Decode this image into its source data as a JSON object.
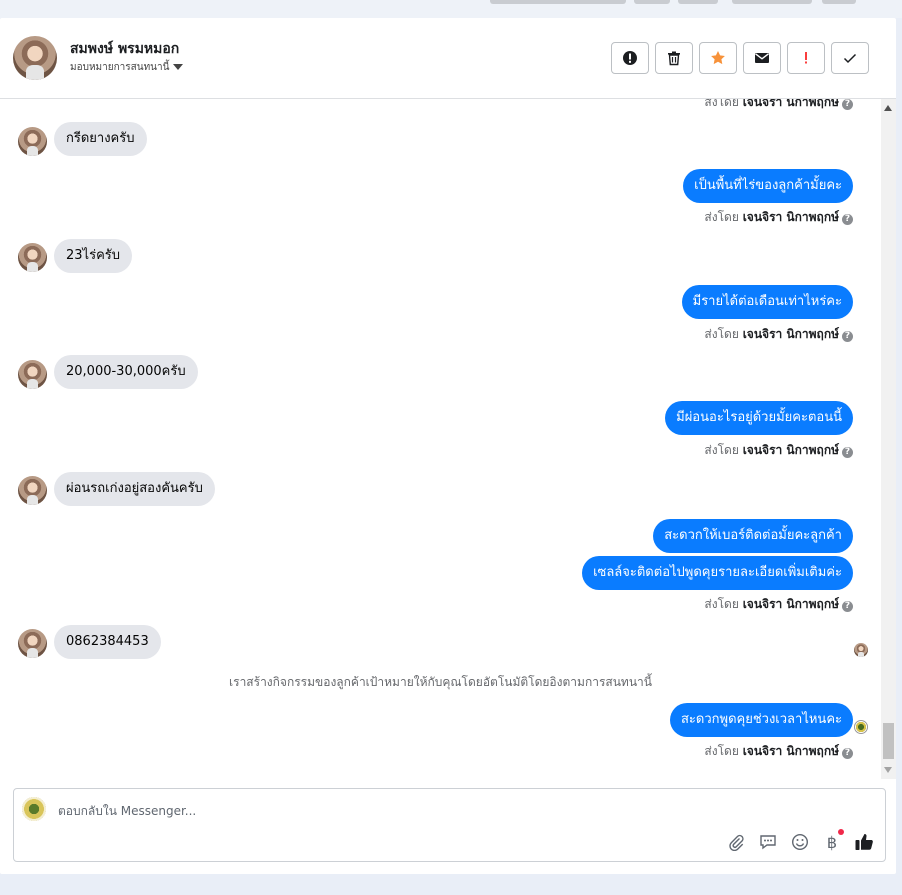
{
  "colors": {
    "accent": "#0a7cff",
    "incoming_bubble": "#e4e6eb",
    "star": "#f7923a",
    "alert": "#fa3e3e"
  },
  "header": {
    "contact_name": "สมพงษ์ พรมหมอก",
    "assign_label": "มอบหมายการสนทนานี้",
    "actions": [
      {
        "name": "mark-spam",
        "icon": "alert-circle-icon"
      },
      {
        "name": "delete",
        "icon": "trash-icon"
      },
      {
        "name": "star",
        "icon": "star-icon"
      },
      {
        "name": "mark-unread",
        "icon": "envelope-icon"
      },
      {
        "name": "mark-important",
        "icon": "exclamation-icon"
      },
      {
        "name": "mark-done",
        "icon": "check-icon"
      }
    ]
  },
  "thread": {
    "sent_prefix": "ส่งโดย",
    "agent_name": "เจนจิรา นิกาพฤกษ์",
    "messages": [
      {
        "dir": "in",
        "text": "กรีดยางครับ"
      },
      {
        "dir": "out",
        "text": "เป็นพื้นที่ไร่ของลูกค้ามั้ยคะ"
      },
      {
        "dir": "in",
        "text": "23ไร่ครับ"
      },
      {
        "dir": "out",
        "text": "มีรายได้ต่อเดือนเท่าไหร่คะ"
      },
      {
        "dir": "in",
        "text": "20,000-30,000ครับ"
      },
      {
        "dir": "out",
        "text": "มีผ่อนอะไรอยู่ด้วยมั้ยคะตอนนี้"
      },
      {
        "dir": "in",
        "text": "ผ่อนรถเก่งอยู่สองคันครับ"
      },
      {
        "dir": "out",
        "text": "สะดวกให้เบอร์ติดต่อมั้ยคะลูกค้า"
      },
      {
        "dir": "out",
        "text": "เซลล์จะติดต่อไปพูดคุยรายละเอียดเพิ่มเติมค่ะ"
      },
      {
        "dir": "in",
        "text": "0862384453"
      },
      {
        "dir": "system",
        "text": "เราสร้างกิจกรรมของลูกค้าเป้าหมายให้กับคุณโดยอัตโนมัติโดยอิงตามการสนทนานี้"
      },
      {
        "dir": "out",
        "text": "สะดวกพูดคุยช่วงเวลาไหนคะ"
      }
    ]
  },
  "composer": {
    "placeholder": "ตอบกลับใน Messenger...",
    "value": "",
    "tools": [
      "paperclip-icon",
      "saved-reply-icon",
      "emoji-icon",
      "baht-icon",
      "thumbs-up-icon"
    ]
  }
}
